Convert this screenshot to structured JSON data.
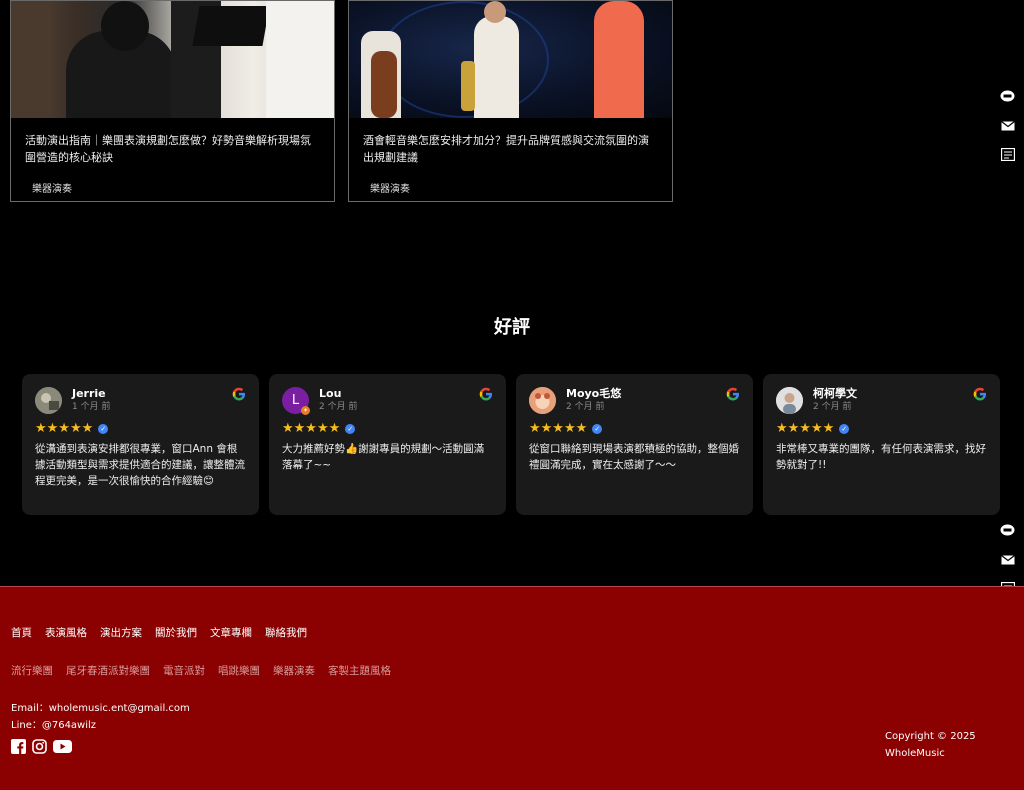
{
  "articles": [
    {
      "title": "活動演出指南｜樂團表演規劃怎麼做？好勢音樂解析現場氛圍營造的核心秘訣",
      "tag": "樂器演奏"
    },
    {
      "title": "酒會輕音樂怎麼安排才加分？提升品牌質感與交流氛圍的演出規劃建議",
      "tag": "樂器演奏"
    }
  ],
  "reviews_section": {
    "title": "好評",
    "reviews": [
      {
        "name": "Jerrie",
        "time": "1 个月 前",
        "text": "從溝通到表演安排都很專業，窗口Ann 會根據活動類型與需求提供適合的建議，讓整體流程更完美，是一次很愉快的合作經驗😊",
        "avatar_letter": "",
        "avatar_color": "#6b6b5c"
      },
      {
        "name": "Lou",
        "time": "2 个月 前",
        "text": "大力推薦好勢👍謝謝專員的規劃～活動圓滿落幕了~~",
        "avatar_letter": "L",
        "avatar_color": "#7b1fa2"
      },
      {
        "name": "Moyo毛悠",
        "time": "2 个月 前",
        "text": "從窗口聯絡到現場表演都積極的協助，整個婚禮圓滿完成，實在太感謝了～～",
        "avatar_letter": "",
        "avatar_color": "#e07a5f"
      },
      {
        "name": "柯柯學文",
        "time": "2 个月 前",
        "text": "非常棒又專業的團隊，有任何表演需求，找好勢就對了!!",
        "avatar_letter": "",
        "avatar_color": "#c8c8c8"
      }
    ],
    "stars": "★★★★★"
  },
  "footer": {
    "nav_main": [
      "首頁",
      "表演風格",
      "演出方案",
      "關於我們",
      "文章專欄",
      "聯絡我們"
    ],
    "nav_sub": [
      "流行樂團",
      "尾牙春酒派對樂團",
      "電音派對",
      "唱跳樂團",
      "樂器演奏",
      "客製主題風格"
    ],
    "email": "Email：wholemusic.ent@gmail.com",
    "line": "Line：@764awilz",
    "copyright_line1": "Copyright © 2025",
    "copyright_line2": "WholeMusic"
  },
  "icons": {
    "line": "line-icon",
    "mail": "mail-icon",
    "form": "form-icon",
    "facebook": "facebook-icon",
    "instagram": "instagram-icon",
    "youtube": "youtube-icon",
    "google": "google-icon"
  },
  "colors": {
    "footer_bg": "#8b0000",
    "star": "#f8bd1b",
    "verified": "#4285f4"
  }
}
